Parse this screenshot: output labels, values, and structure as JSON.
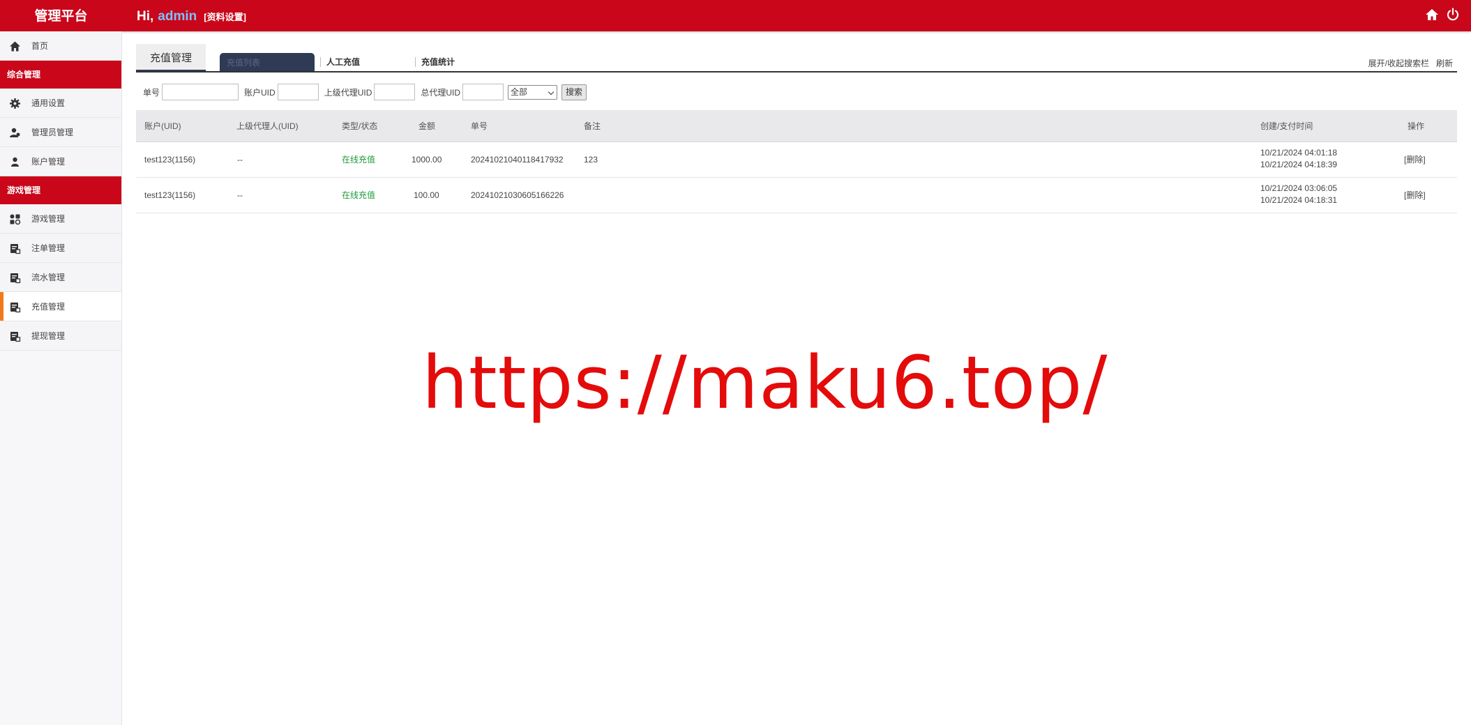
{
  "header": {
    "brand": "管理平台",
    "greeting": "Hi,",
    "username": "admin",
    "profile_link": "[资料设置]",
    "icons": [
      "home-icon",
      "power-icon"
    ]
  },
  "sidebar": {
    "home": "首页",
    "section1": "综合管理",
    "general_settings": "通用设置",
    "admin_management": "管理员管理",
    "account_management": "账户管理",
    "section2": "游戏管理",
    "game_management": "游戏管理",
    "bet_management": "注单管理",
    "flow_management": "流水管理",
    "recharge_management": "充值管理",
    "withdraw_management": "提现管理"
  },
  "tabs": {
    "title": "充值管理",
    "items": [
      "充值列表",
      "人工充值",
      "充值统计"
    ],
    "toggle_search": "展开/收起搜索栏",
    "refresh": "刷新"
  },
  "search": {
    "order_no_label": "单号",
    "account_uid_label": "账户UID",
    "parent_agent_label": "上级代理UID",
    "top_agent_label": "总代理UID",
    "type_selected": "全部",
    "search_button": "搜索"
  },
  "table": {
    "columns": [
      "账户(UID)",
      "上级代理人(UID)",
      "类型/状态",
      "金额",
      "单号",
      "备注",
      "创建/支付时间",
      "操作"
    ],
    "rows": [
      {
        "account": "test123(1156)",
        "parent": "--",
        "status": "在线充值",
        "amount": "1000.00",
        "order_no": "20241021040118417932",
        "remark": "123",
        "created": "10/21/2024 04:01:18",
        "paid": "10/21/2024 04:18:39",
        "action": "[删除]"
      },
      {
        "account": "test123(1156)",
        "parent": "--",
        "status": "在线充值",
        "amount": "100.00",
        "order_no": "20241021030605166226",
        "remark": "",
        "created": "10/21/2024 03:06:05",
        "paid": "10/21/2024 04:18:31",
        "action": "[删除]"
      }
    ]
  },
  "watermark": "https://maku6.top/",
  "colors": {
    "brand_red": "#c9061a",
    "active_tab": "#2f3a55",
    "status_green": "#1e9a3a",
    "active_indicator": "#f07a1a"
  }
}
